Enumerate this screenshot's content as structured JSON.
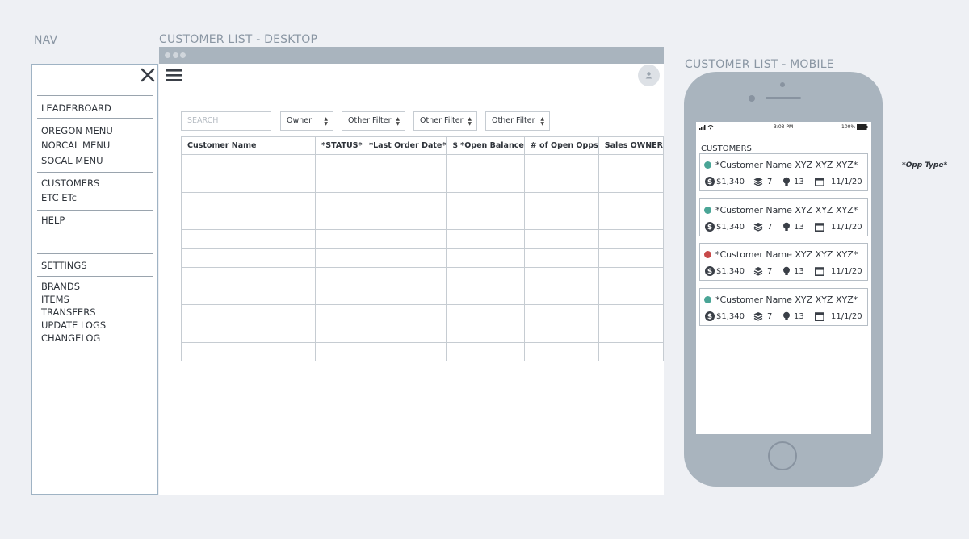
{
  "labels": {
    "nav": "NAV",
    "desktop": "CUSTOMER LIST - DESKTOP",
    "mobile": "CUSTOMER LIST - MOBILE",
    "opp_type": "*Opp Type*"
  },
  "nav": {
    "items": {
      "leaderboard": "LEADERBOARD",
      "oregon": "OREGON MENU",
      "norcal": "NORCAL MENU",
      "socal": "SOCAL MENU",
      "customers": "CUSTOMERS",
      "etc": "ETC ETc",
      "help": "HELP",
      "settings": "SETTINGS",
      "brands": "BRANDS",
      "items": "ITEMS",
      "transfers": "TRANSFERS",
      "update_logs": "UPDATE LOGS",
      "changelog": "CHANGELOG"
    }
  },
  "desktop": {
    "search_placeholder": "SEARCH",
    "filters": [
      "Owner",
      "Other Filter",
      "Other Filter",
      "Other Filter"
    ],
    "columns": [
      "Customer Name",
      "*STATUS*",
      "*Last Order Date*",
      "$ *Open Balance",
      "# of Open Opps",
      "Sales OWNER"
    ]
  },
  "mobile": {
    "status": {
      "time": "3:03 PM",
      "battery": "100%"
    },
    "heading": "CUSTOMERS",
    "cards": [
      {
        "name": "*Customer Name XYZ XYZ XYZ*",
        "balance": "$1,340",
        "stack": "7",
        "ideas": "13",
        "date": "11/1/20",
        "status_color": "#4aa596"
      },
      {
        "name": "*Customer Name XYZ XYZ XYZ*",
        "balance": "$1,340",
        "stack": "7",
        "ideas": "13",
        "date": "11/1/20",
        "status_color": "#4aa596"
      },
      {
        "name": "*Customer Name XYZ XYZ XYZ*",
        "balance": "$1,340",
        "stack": "7",
        "ideas": "13",
        "date": "11/1/20",
        "status_color": "#c84a4a"
      },
      {
        "name": "*Customer Name XYZ XYZ XYZ*",
        "balance": "$1,340",
        "stack": "7",
        "ideas": "13",
        "date": "11/1/20",
        "status_color": "#4aa596"
      }
    ]
  }
}
